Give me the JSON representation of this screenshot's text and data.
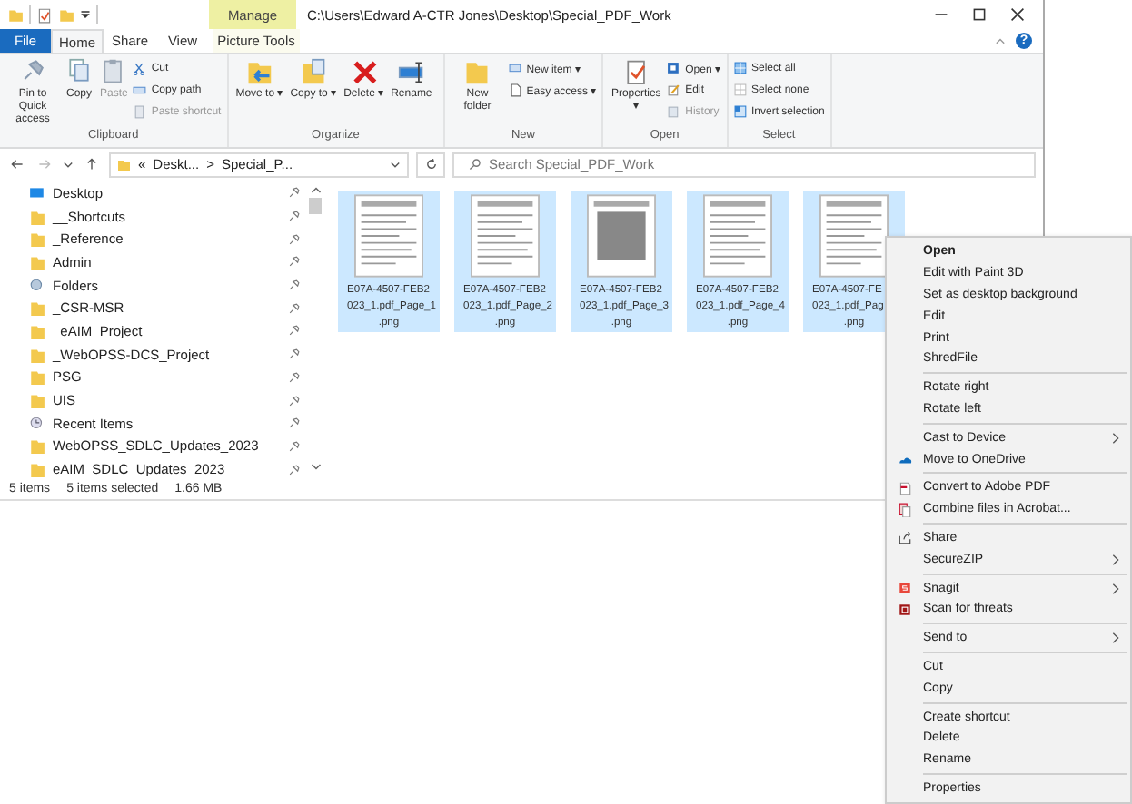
{
  "window": {
    "title": "C:\\Users\\Edward A-CTR Jones\\Desktop\\Special_PDF_Work",
    "contextual_tab": "Manage",
    "help": "?"
  },
  "file_tab": "File",
  "tabs": [
    {
      "label": "Home",
      "selected": true
    },
    {
      "label": "Share",
      "selected": false
    },
    {
      "label": "View",
      "selected": false
    },
    {
      "label": "Picture Tools",
      "selected": false
    }
  ],
  "ribbon": [
    {
      "name": "Clipboard",
      "buttons": [
        {
          "label": "Pin to Quick access",
          "kind": "large",
          "disabled": false
        },
        {
          "label": "Copy",
          "kind": "large",
          "disabled": false
        },
        {
          "label": "Paste",
          "kind": "large",
          "disabled": true
        },
        {
          "label": "Cut",
          "kind": "small",
          "disabled": false
        },
        {
          "label": "Copy path",
          "kind": "small",
          "disabled": false
        },
        {
          "label": "Paste shortcut",
          "kind": "small",
          "disabled": true
        }
      ]
    },
    {
      "name": "Organize",
      "buttons": [
        {
          "label": "Move to ▾",
          "kind": "large",
          "disabled": false
        },
        {
          "label": "Copy to ▾",
          "kind": "large",
          "disabled": false
        },
        {
          "label": "Delete ▾",
          "kind": "large",
          "disabled": false
        },
        {
          "label": "Rename",
          "kind": "large",
          "disabled": false
        }
      ]
    },
    {
      "name": "New",
      "buttons": [
        {
          "label": "New folder",
          "kind": "large",
          "disabled": false
        },
        {
          "label": "New item ▾",
          "kind": "small",
          "disabled": false
        },
        {
          "label": "Easy access ▾",
          "kind": "small",
          "disabled": false
        }
      ]
    },
    {
      "name": "Open",
      "buttons": [
        {
          "label": "Properties ▾",
          "kind": "large",
          "disabled": false
        },
        {
          "label": "Open ▾",
          "kind": "small",
          "disabled": false
        },
        {
          "label": "Edit",
          "kind": "small",
          "disabled": false
        },
        {
          "label": "History",
          "kind": "small",
          "disabled": true
        }
      ]
    },
    {
      "name": "Select",
      "buttons": [
        {
          "label": "Select all",
          "kind": "small",
          "disabled": false
        },
        {
          "label": "Select none",
          "kind": "small",
          "disabled": false
        },
        {
          "label": "Invert selection",
          "kind": "small",
          "disabled": false
        }
      ]
    }
  ],
  "address": {
    "overflow": "«",
    "crumbs": [
      "Deskt...",
      "Special_P..."
    ],
    "separator": ">"
  },
  "search": {
    "placeholder": "Search Special_PDF_Work"
  },
  "sidebar": {
    "items": [
      {
        "label": "Desktop",
        "kind": "desktop"
      },
      {
        "label": "__Shortcuts",
        "kind": "folder"
      },
      {
        "label": "_Reference",
        "kind": "folder"
      },
      {
        "label": "Admin",
        "kind": "folder"
      },
      {
        "label": "Folders",
        "kind": "library"
      },
      {
        "label": "_CSR-MSR",
        "kind": "folder"
      },
      {
        "label": "_eAIM_Project",
        "kind": "folder"
      },
      {
        "label": "_WebOPSS-DCS_Project",
        "kind": "folder"
      },
      {
        "label": "PSG",
        "kind": "folder"
      },
      {
        "label": "UIS",
        "kind": "folder"
      },
      {
        "label": "Recent Items",
        "kind": "recent"
      },
      {
        "label": "WebOPSS_SDLC_Updates_2023",
        "kind": "folder"
      },
      {
        "label": "eAIM_SDLC_Updates_2023",
        "kind": "folder"
      }
    ]
  },
  "files": [
    {
      "name": [
        "E07A-4507-FEB2",
        "023_1.pdf_Page_1",
        ".png"
      ],
      "selected": true
    },
    {
      "name": [
        "E07A-4507-FEB2",
        "023_1.pdf_Page_2",
        ".png"
      ],
      "selected": true
    },
    {
      "name": [
        "E07A-4507-FEB2",
        "023_1.pdf_Page_3",
        ".png"
      ],
      "selected": true
    },
    {
      "name": [
        "E07A-4507-FEB2",
        "023_1.pdf_Page_4",
        ".png"
      ],
      "selected": true
    },
    {
      "name": [
        "E07A-4507-FE",
        "023_1.pdf_Pag",
        ".png"
      ],
      "selected": true
    }
  ],
  "status_bar": {
    "count": "5 items",
    "selected": "5 items selected",
    "size": "1.66 MB"
  },
  "context_menu": [
    [
      {
        "label": "Open",
        "kind": "default"
      },
      {
        "label": "Edit with Paint 3D",
        "kind": "command"
      },
      {
        "label": "Set as desktop background",
        "kind": "command"
      },
      {
        "label": "Edit",
        "kind": "command"
      },
      {
        "label": "Print",
        "kind": "command"
      },
      {
        "label": "ShredFile",
        "kind": "command"
      }
    ],
    [
      {
        "label": "Rotate right",
        "kind": "command"
      },
      {
        "label": "Rotate left",
        "kind": "command"
      }
    ],
    [
      {
        "label": "Cast to Device",
        "kind": "submenu"
      },
      {
        "label": "Move to OneDrive",
        "kind": "command"
      }
    ],
    [
      {
        "label": "Convert to Adobe PDF",
        "kind": "command"
      },
      {
        "label": "Combine files in Acrobat...",
        "kind": "command"
      }
    ],
    [
      {
        "label": "Share",
        "kind": "command"
      },
      {
        "label": "SecureZIP",
        "kind": "submenu"
      }
    ],
    [
      {
        "label": "Snagit",
        "kind": "submenu"
      },
      {
        "label": "Scan for threats",
        "kind": "command"
      }
    ],
    [
      {
        "label": "Send to",
        "kind": "submenu"
      }
    ],
    [
      {
        "label": "Cut",
        "kind": "command"
      },
      {
        "label": "Copy",
        "kind": "command"
      }
    ],
    [
      {
        "label": "Create shortcut",
        "kind": "command"
      },
      {
        "label": "Delete",
        "kind": "command"
      },
      {
        "label": "Rename",
        "kind": "command"
      }
    ],
    [
      {
        "label": "Properties",
        "kind": "command"
      }
    ]
  ]
}
